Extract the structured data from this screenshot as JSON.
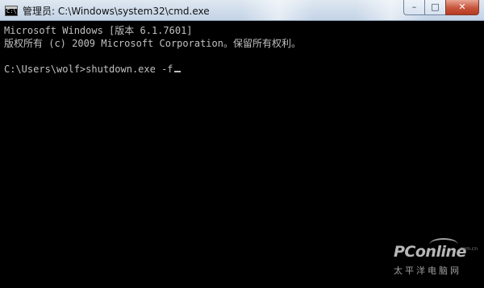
{
  "window": {
    "title": "管理员: C:\\Windows\\system32\\cmd.exe",
    "icon_name": "cmd-icon",
    "controls": {
      "minimize_glyph": "–",
      "maximize_glyph": "□",
      "close_glyph": "✕"
    }
  },
  "console": {
    "lines": [
      "Microsoft Windows [版本 6.1.7601]",
      "版权所有 (c) 2009 Microsoft Corporation。保留所有权利。",
      "",
      "C:\\Users\\wolf>shutdown.exe -f"
    ],
    "text_color": "#c0c0c0",
    "background_color": "#000000"
  },
  "watermark": {
    "logo": "PConline",
    "domain": ".com.cn",
    "subtitle": "太平洋电脑网"
  }
}
